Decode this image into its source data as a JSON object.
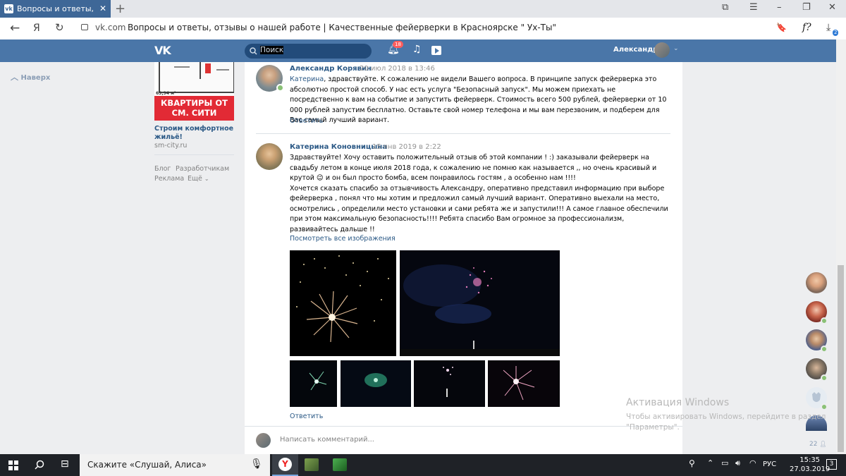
{
  "browser": {
    "tab_title": "Вопросы и ответы, отзыв",
    "tab_close": "✕",
    "new_tab": "+",
    "favicon": "vk",
    "back_icon": "←",
    "yandex_icon": "Я",
    "reload_icon": "↻",
    "url_host": "vk.com",
    "url_title": "Вопросы и ответы, отзывы о нашей работе | Качественные фейерверки в Красноярске \" Ух-Ты\"",
    "formula_icon": "f?",
    "download_count": "2"
  },
  "vk_header": {
    "logo": "VK",
    "search_placeholder": "Поиск",
    "notifications_count": "18",
    "user_name": "Александр"
  },
  "left": {
    "back_to_top": "Наверх",
    "ad": {
      "area": "63,94 м²",
      "banner": "КВАРТИРЫ ОТ СМ. СИТИ",
      "title": "Строим комфортное жильё!",
      "site": "sm-city.ru"
    },
    "footer": {
      "blog": "Блог",
      "developers": "Разработчикам",
      "ads": "Реклама",
      "more": "Ещё"
    }
  },
  "comments": [
    {
      "author": "Александр Корявин",
      "date": "20 июл 2018 в 13:46",
      "mention": "Катерина",
      "text": ", здравствуйте. К сожалению не видели Вашего вопроса. В принципе запуск фейерверка это абсолютно простой способ. У нас есть услуга \"Безопасный запуск\". Мы можем приехать не посредственно к вам на событие и запустить фейерверк. Стоимость всего 500 рублей, фейерверки от 10 000 рублей запустим бесплатно. Оставьте свой номер телефона и мы вам перезвоним, и подберем для Вас самый лучший вариант.",
      "reply": "Ответить"
    },
    {
      "author": "Катерина Коновницына",
      "date": "15 янв 2019 в 2:22",
      "text1": "Здравствуйте! Хочу оставить положительный отзыв об этой компании ! :) заказывали фейерверк на свадьбу летом в конце июля 2018 года, к сожалению не помню как называется ,, но очень красивый и крутой 😉 и он был просто бомба, всем понравилось гостям , а особенно нам !!!!",
      "text2": "Хочется сказать спасибо за отзывчивость Александру, оперативно представил информацию при выборе фейерверка , понял что мы хотим и предложил самый лучший вариант. Оперативно выехали на место, осмотрелись , определили место установки и сами ребята же и запустили!!! А самое главное обеспечили при этом максимальную безопасность!!!! Ребята спасибо Вам огромное за профессионализм, развивайтесь дальше !!",
      "see_all": "Посмотреть все изображения",
      "reply": "Ответить"
    }
  ],
  "comment_input": {
    "placeholder": "Написать комментарий..."
  },
  "chat": {
    "count": "22"
  },
  "watermark": {
    "title": "Активация Windows",
    "line1": "Чтобы активировать Windows, перейдите в раздел",
    "line2": "\"Параметры\"."
  },
  "taskbar": {
    "search_text": "Скажите «Слушай, Алиса»",
    "lang": "РУС",
    "time": "15:35",
    "date": "27.03.2019",
    "notif_count": "3"
  },
  "colors": {
    "vk_blue": "#4a76a8",
    "link": "#2a5885",
    "ad_red": "#e22a35",
    "taskbar": "#1f2227"
  }
}
